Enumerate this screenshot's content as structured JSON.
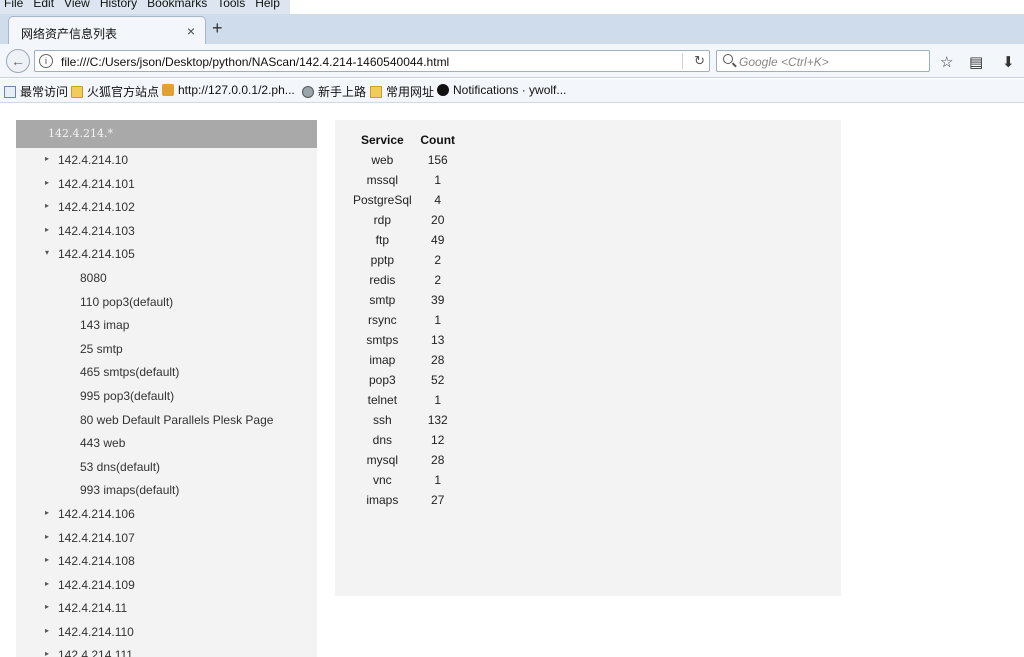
{
  "menu": [
    "File",
    "Edit",
    "View",
    "History",
    "Bookmarks",
    "Tools",
    "Help"
  ],
  "tab": {
    "title": "网络资产信息列表",
    "close": "×",
    "new_tab": "+"
  },
  "nav": {
    "url": "file:///C:/Users/json/Desktop/python/NAScan/142.4.214-1460540044.html",
    "search_placeholder": "Google <Ctrl+K>",
    "reload": "↻",
    "back": "←"
  },
  "bookmarks": [
    {
      "label": "最常访问",
      "icon": "page-icon"
    },
    {
      "label": "火狐官方站点",
      "icon": "folder-icon"
    },
    {
      "label": "http://127.0.0.1/2.ph...",
      "icon": "hand-icon"
    },
    {
      "label": "新手上路",
      "icon": "globe-icon"
    },
    {
      "label": "常用网址",
      "icon": "folder-icon"
    },
    {
      "label": "Notifications · ywolf...",
      "icon": "github-icon"
    }
  ],
  "sidebar": {
    "header": "142.4.214.*",
    "rows": [
      {
        "label": "142.4.214.10",
        "arrow": "▸",
        "level": 0
      },
      {
        "label": "142.4.214.101",
        "arrow": "▸",
        "level": 0
      },
      {
        "label": "142.4.214.102",
        "arrow": "▸",
        "level": 0
      },
      {
        "label": "142.4.214.103",
        "arrow": "▸",
        "level": 0
      },
      {
        "label": "142.4.214.105",
        "arrow": "▾",
        "level": 0
      },
      {
        "label": "8080",
        "arrow": "",
        "level": 1
      },
      {
        "label": "110 pop3(default)",
        "arrow": "",
        "level": 1
      },
      {
        "label": "143 imap",
        "arrow": "",
        "level": 1
      },
      {
        "label": "25 smtp",
        "arrow": "",
        "level": 1
      },
      {
        "label": "465 smtps(default)",
        "arrow": "",
        "level": 1
      },
      {
        "label": "995 pop3(default)",
        "arrow": "",
        "level": 1
      },
      {
        "label": "80 web Default Parallels Plesk Page",
        "arrow": "",
        "level": 1
      },
      {
        "label": "443 web",
        "arrow": "",
        "level": 1
      },
      {
        "label": "53 dns(default)",
        "arrow": "",
        "level": 1
      },
      {
        "label": "993 imaps(default)",
        "arrow": "",
        "level": 1
      },
      {
        "label": "142.4.214.106",
        "arrow": "▸",
        "level": 0
      },
      {
        "label": "142.4.214.107",
        "arrow": "▸",
        "level": 0
      },
      {
        "label": "142.4.214.108",
        "arrow": "▸",
        "level": 0
      },
      {
        "label": "142.4.214.109",
        "arrow": "▸",
        "level": 0
      },
      {
        "label": "142.4.214.11",
        "arrow": "▸",
        "level": 0
      },
      {
        "label": "142.4.214.110",
        "arrow": "▸",
        "level": 0
      },
      {
        "label": "142.4.214.111",
        "arrow": "▸",
        "level": 0
      }
    ]
  },
  "services": {
    "headers": [
      "Service",
      "Count"
    ],
    "rows": [
      [
        "web",
        "156"
      ],
      [
        "mssql",
        "1"
      ],
      [
        "PostgreSql",
        "4"
      ],
      [
        "rdp",
        "20"
      ],
      [
        "ftp",
        "49"
      ],
      [
        "pptp",
        "2"
      ],
      [
        "redis",
        "2"
      ],
      [
        "smtp",
        "39"
      ],
      [
        "rsync",
        "1"
      ],
      [
        "smtps",
        "13"
      ],
      [
        "imap",
        "28"
      ],
      [
        "pop3",
        "52"
      ],
      [
        "telnet",
        "1"
      ],
      [
        "ssh",
        "132"
      ],
      [
        "dns",
        "12"
      ],
      [
        "mysql",
        "28"
      ],
      [
        "vnc",
        "1"
      ],
      [
        "imaps",
        "27"
      ]
    ]
  }
}
